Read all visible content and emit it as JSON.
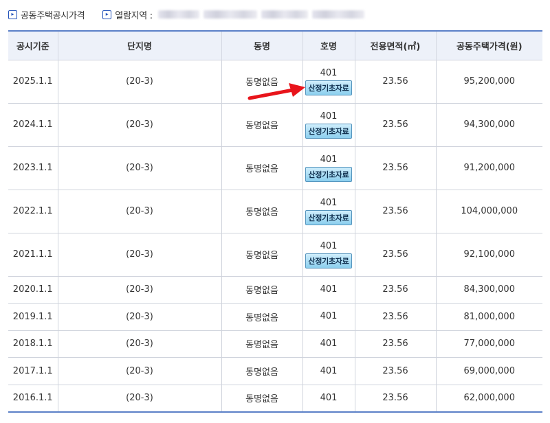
{
  "breadcrumbs": {
    "title": "공동주택공시가격",
    "area_label": "열람지역 :"
  },
  "table": {
    "headers": [
      "공시기준",
      "단지명",
      "동명",
      "호명",
      "전용면적(㎡)",
      "공동주택가격(원)"
    ],
    "basis_button_label": "산정기초자료",
    "rows": [
      {
        "date": "2025.1.1",
        "complex": "(20-3)",
        "dong": "동명없음",
        "ho": "401",
        "area": "23.56",
        "price": "95,200,000",
        "has_basis": true
      },
      {
        "date": "2024.1.1",
        "complex": "(20-3)",
        "dong": "동명없음",
        "ho": "401",
        "area": "23.56",
        "price": "94,300,000",
        "has_basis": true
      },
      {
        "date": "2023.1.1",
        "complex": "(20-3)",
        "dong": "동명없음",
        "ho": "401",
        "area": "23.56",
        "price": "91,200,000",
        "has_basis": true
      },
      {
        "date": "2022.1.1",
        "complex": "(20-3)",
        "dong": "동명없음",
        "ho": "401",
        "area": "23.56",
        "price": "104,000,000",
        "has_basis": true
      },
      {
        "date": "2021.1.1",
        "complex": "(20-3)",
        "dong": "동명없음",
        "ho": "401",
        "area": "23.56",
        "price": "92,100,000",
        "has_basis": true
      },
      {
        "date": "2020.1.1",
        "complex": "(20-3)",
        "dong": "동명없음",
        "ho": "401",
        "area": "23.56",
        "price": "84,300,000",
        "has_basis": false
      },
      {
        "date": "2019.1.1",
        "complex": "(20-3)",
        "dong": "동명없음",
        "ho": "401",
        "area": "23.56",
        "price": "81,000,000",
        "has_basis": false
      },
      {
        "date": "2018.1.1",
        "complex": "(20-3)",
        "dong": "동명없음",
        "ho": "401",
        "area": "23.56",
        "price": "77,000,000",
        "has_basis": false
      },
      {
        "date": "2017.1.1",
        "complex": "(20-3)",
        "dong": "동명없음",
        "ho": "401",
        "area": "23.56",
        "price": "69,000,000",
        "has_basis": false
      },
      {
        "date": "2016.1.1",
        "complex": "(20-3)",
        "dong": "동명없음",
        "ho": "401",
        "area": "23.56",
        "price": "62,000,000",
        "has_basis": false
      }
    ]
  },
  "colors": {
    "accent_border": "#5a7fc7",
    "header_bg": "#edf1f9",
    "button_bg": "#8ccfee",
    "arrow": "#e8141b"
  }
}
